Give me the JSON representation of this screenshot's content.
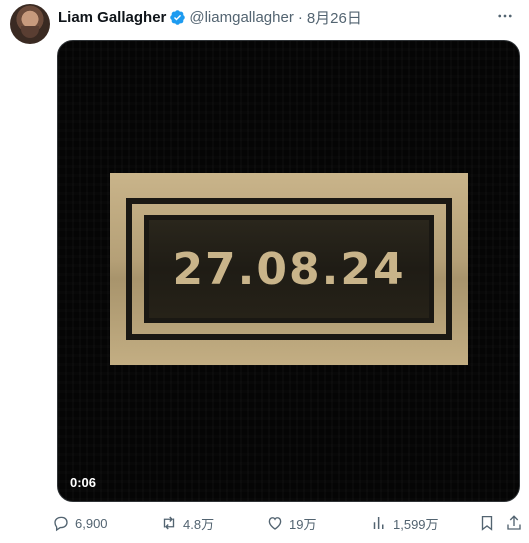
{
  "author": {
    "name": "Liam Gallagher",
    "handle": "@liamgallagher",
    "separator": "·",
    "date": "8月26日",
    "verified": true
  },
  "media": {
    "plaque_text": "27.08.24",
    "timecode": "0:06"
  },
  "actions": {
    "replies": "6,900",
    "reposts": "4.8万",
    "likes": "19万",
    "views": "1,599万"
  },
  "colors": {
    "verified_blue": "#1d9bf0",
    "muted": "#536471",
    "plaque_gold": "#c9b48a"
  },
  "icons": [
    "more-icon",
    "verified-badge-icon",
    "reply-icon",
    "repost-icon",
    "like-icon",
    "views-icon",
    "bookmark-icon",
    "share-icon"
  ]
}
